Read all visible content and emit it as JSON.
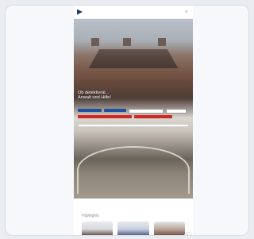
{
  "header": {
    "logo_text": "",
    "menu_icon": "menu-icon"
  },
  "hero": {
    "title_line1": "Ob detektivrät...",
    "title_line2": "Anwalt und Hilfe!"
  },
  "buttons": {
    "row1": [
      "",
      "",
      "",
      ""
    ],
    "row2": [
      "",
      ""
    ]
  },
  "search": {
    "placeholder": ""
  },
  "sections": {
    "highlights_title": "Highlights"
  }
}
